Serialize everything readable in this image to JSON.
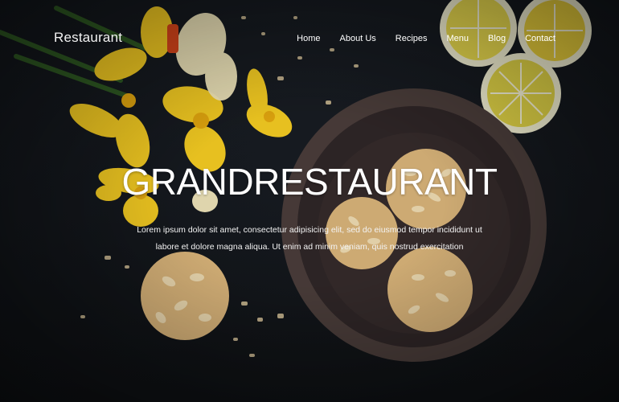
{
  "brand": {
    "name": "Restaurant"
  },
  "nav": {
    "items": [
      {
        "label": "Home"
      },
      {
        "label": "About Us"
      },
      {
        "label": "Recipes"
      },
      {
        "label": "Menu"
      },
      {
        "label": "Blog"
      },
      {
        "label": "Contact"
      }
    ]
  },
  "hero": {
    "title": "GRANDRESTAURANT",
    "text": "Lorem ipsum dolor sit amet, consectetur adipisicing elit, sed do eiusmod tempor incididunt ut labore et dolore magna aliqua. Ut enim ad minim veniam, quis nostrud exercitation"
  },
  "colors": {
    "background": "#15191e",
    "text": "#ffffff",
    "flower": "#f2c21b",
    "lemon": "#e9d24a"
  }
}
